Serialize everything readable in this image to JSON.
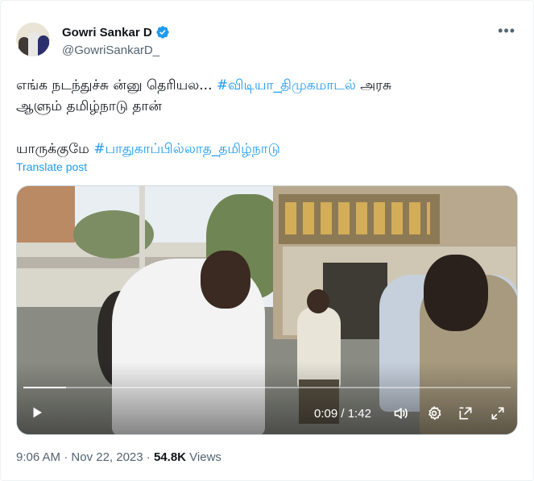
{
  "author": {
    "display_name": "Gowri Sankar D",
    "handle": "@GowriSankarD_",
    "verified": true,
    "verified_icon": "verified-badge-icon",
    "verified_color": "#1d9bf0"
  },
  "tweet": {
    "line1_text": "எங்க நடந்துச்சு ன்னு தெரியல... ",
    "line1_hashtag": "#விடியா_திமுகமாடல்",
    "line1_after": " அரசு",
    "line2_text": "ஆளும் தமிழ்நாடு தான்",
    "line3_text": "யாருக்குமே ",
    "line3_hashtag": "#பாதுகாப்பில்லாத_தமிழ்நாடு",
    "translate_label": "Translate post"
  },
  "video": {
    "current_time": "0:09",
    "separator": " / ",
    "duration": "1:42",
    "progress": 0.088,
    "icons": [
      "play-icon",
      "volume-icon",
      "settings-icon",
      "popout-icon",
      "fullscreen-icon"
    ]
  },
  "meta": {
    "time": "9:06 AM",
    "dot1": " · ",
    "date": "Nov 22, 2023",
    "dot2": " · ",
    "views_count": "54.8K",
    "views_label": " Views"
  },
  "colors": {
    "accent": "#1d9bf0",
    "text_primary": "#0f1419",
    "text_secondary": "#536471"
  }
}
